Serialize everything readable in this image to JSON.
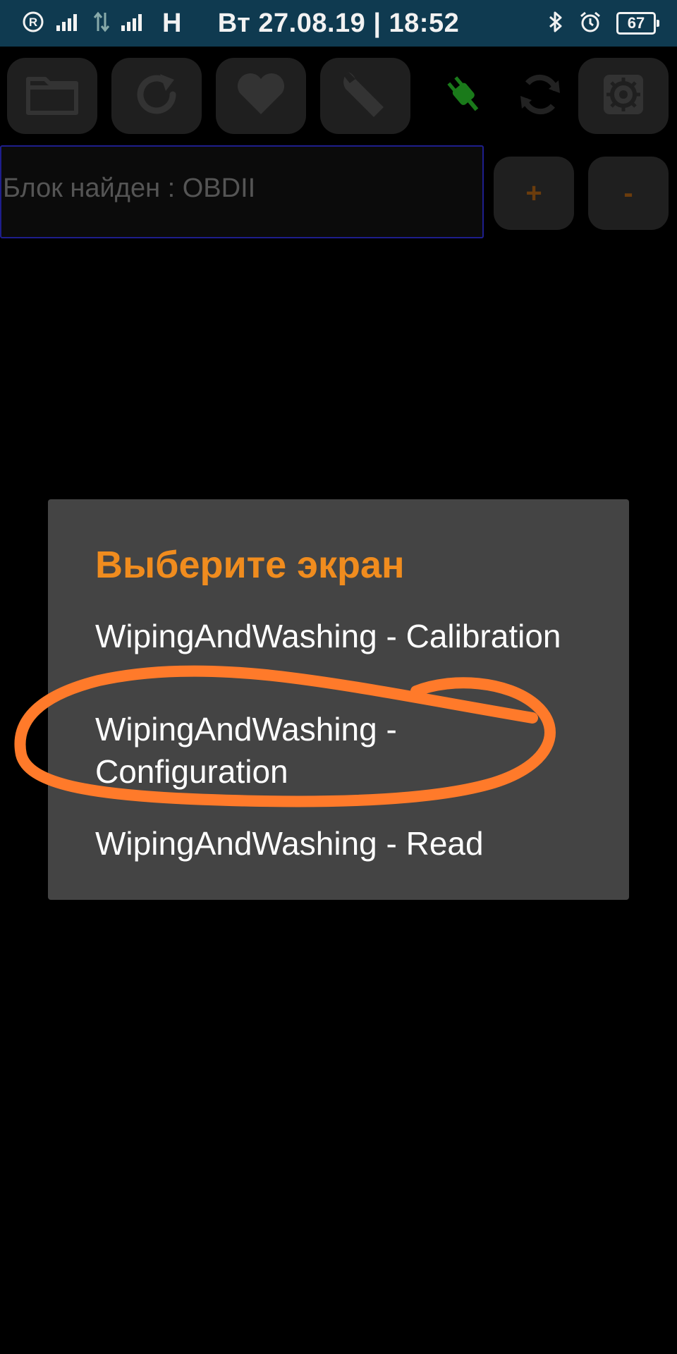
{
  "status_bar": {
    "datetime": "Вт 27.08.19 | 18:52",
    "network_type": "H",
    "battery": "67",
    "background_color": "#0f3a50"
  },
  "toolbar": {
    "icons": [
      "folder-icon",
      "refresh-icon",
      "heart-icon",
      "wrench-icon",
      "plug-icon",
      "sync-icon",
      "gear-icon"
    ],
    "connected_color": "#1a7a1a"
  },
  "info": {
    "status_text": "Блок найден : OBDII",
    "plus_label": "+",
    "minus_label": "-"
  },
  "dialog": {
    "title": "Выберите экран",
    "items": [
      "WipingAndWashing - Calibration",
      "WipingAndWashing - Configuration",
      "WipingAndWashing - Read"
    ],
    "title_color": "#f08c1e",
    "background_color": "#444444"
  },
  "annotation": {
    "color": "#ff7a2a"
  }
}
